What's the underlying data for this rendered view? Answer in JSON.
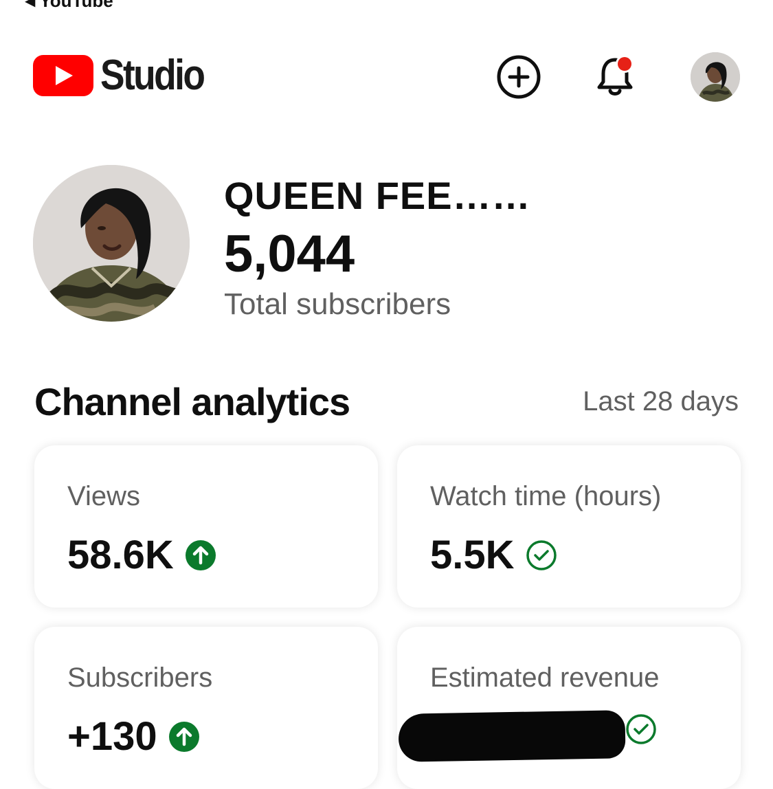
{
  "status_bar": {
    "back_label": "YouTube"
  },
  "header": {
    "logo_text": "Studio",
    "brand_color": "#ff0000",
    "icons": [
      "create-plus-icon",
      "notification-bell-icon",
      "account-avatar"
    ],
    "notification_dot_color": "#e62117"
  },
  "channel": {
    "name": "QUEEN FEE……",
    "subscriber_count": "5,044",
    "subscriber_label": "Total subscribers"
  },
  "analytics": {
    "title": "Channel analytics",
    "range": "Last 28 days",
    "cards": [
      {
        "label": "Views",
        "value": "58.6K",
        "status_icon": "arrow-up-circle-icon"
      },
      {
        "label": "Watch time (hours)",
        "value": "5.5K",
        "status_icon": "check-circle-icon"
      },
      {
        "label": "Subscribers",
        "value": "+130",
        "status_icon": "arrow-up-circle-icon"
      },
      {
        "label": "Estimated revenue",
        "value": "",
        "status_icon": "check-circle-icon",
        "redacted": true
      }
    ],
    "status_color": "#0b7a2c"
  }
}
